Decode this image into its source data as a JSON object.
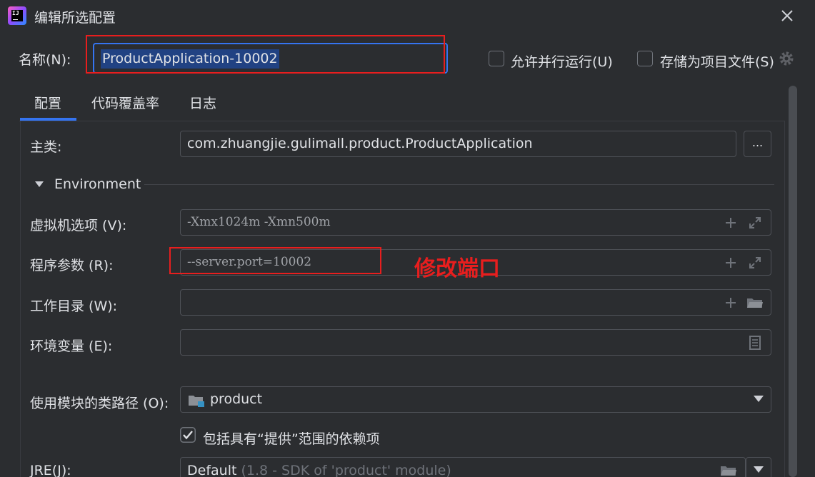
{
  "window": {
    "logo_text": "IJ",
    "title": "编辑所选配置"
  },
  "name_row": {
    "label": "名称(N):",
    "value": "ProductApplication-10002"
  },
  "options": {
    "parallel_run_label": "允许并行运行(U)",
    "store_as_project_file_label": "存储为项目文件(S)"
  },
  "tabs": [
    {
      "label": "配置",
      "active": true
    },
    {
      "label": "代码覆盖率",
      "active": false
    },
    {
      "label": "日志",
      "active": false
    }
  ],
  "main_class": {
    "label": "主类:",
    "value": "com.zhuangjie.gulimall.product.ProductApplication",
    "browse_label": "..."
  },
  "environment": {
    "section_title": "Environment",
    "vm_options": {
      "label": "虚拟机选项 (V):",
      "value": "-Xmx1024m -Xmn500m"
    },
    "program_args": {
      "label": "程序参数 (R):",
      "value": "--server.port=10002"
    },
    "working_dir": {
      "label": "工作目录 (W):",
      "value": ""
    },
    "env_vars": {
      "label": "环境变量 (E):",
      "value": ""
    }
  },
  "classpath": {
    "label": "使用模块的类路径 (O):",
    "value": "product"
  },
  "provided_scope": {
    "label": "包括具有“提供”范围的依赖项",
    "checked": true
  },
  "jre": {
    "label": "JRE(J):",
    "value": "Default",
    "detail": "(1.8 - SDK of 'product' module)"
  },
  "annotation": {
    "text": "修改端口",
    "color": "#e81e1e"
  },
  "colors": {
    "background": "#2b2d30",
    "accent": "#3574f0",
    "selection": "#214283",
    "annotation": "#e81e1e"
  }
}
